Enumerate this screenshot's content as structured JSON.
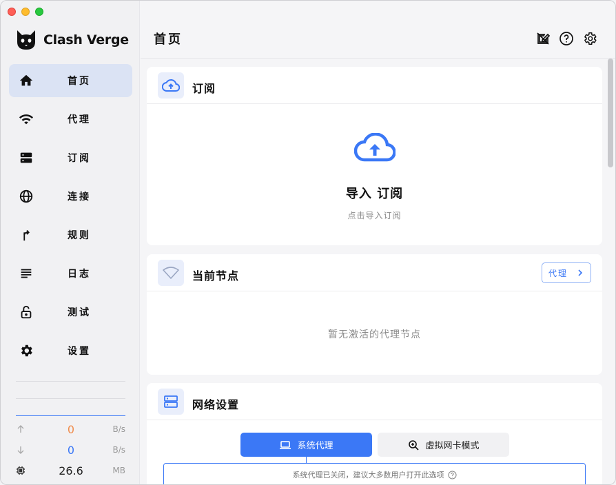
{
  "app": {
    "name": "Clash Verge"
  },
  "sidebar": {
    "items": [
      {
        "label": "首页",
        "icon": "home-icon",
        "active": true
      },
      {
        "label": "代理",
        "icon": "wifi-icon"
      },
      {
        "label": "订阅",
        "icon": "storage-icon"
      },
      {
        "label": "连接",
        "icon": "globe-icon"
      },
      {
        "label": "规则",
        "icon": "fork-icon"
      },
      {
        "label": "日志",
        "icon": "list-icon"
      },
      {
        "label": "测试",
        "icon": "lock-open-icon"
      },
      {
        "label": "设置",
        "icon": "gear-icon"
      }
    ],
    "traffic": {
      "upload": {
        "value": "0",
        "unit": "B/s",
        "color": "#f08c4c"
      },
      "download": {
        "value": "0",
        "unit": "B/s",
        "color": "#3b78f6"
      },
      "memory": {
        "value": "26.6",
        "unit": "MB"
      }
    }
  },
  "header": {
    "title": "首页",
    "icons": [
      "edit-layout-icon",
      "help-icon",
      "gear-icon"
    ]
  },
  "cards": {
    "subscription": {
      "title": "订阅",
      "import_title": "导入 订阅",
      "import_subtitle": "点击导入订阅"
    },
    "current_node": {
      "title": "当前节点",
      "proxy_button": "代理",
      "empty_message": "暂无激活的代理节点"
    },
    "network": {
      "title": "网络设置",
      "tabs": [
        {
          "label": "系统代理",
          "active": true
        },
        {
          "label": "虚拟网卡模式",
          "active": false
        }
      ],
      "description": "系统代理已关闭，建议大多数用户打开此选项"
    }
  },
  "colors": {
    "accent": "#3b78f6"
  }
}
